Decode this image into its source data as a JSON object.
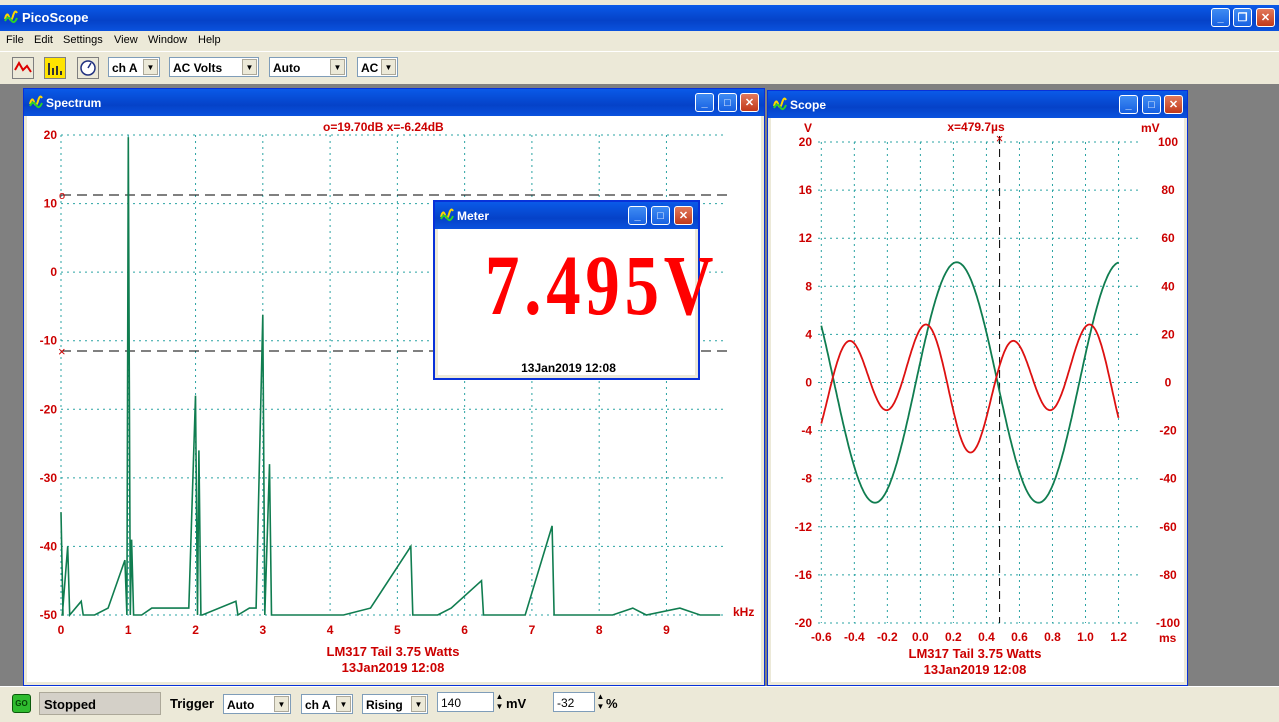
{
  "app": {
    "title": "PicoScope"
  },
  "menu": [
    "File",
    "Edit",
    "Settings",
    "View",
    "Window",
    "Help"
  ],
  "toolbar": {
    "channel": "ch A",
    "mode": "AC Volts",
    "range": "Auto",
    "coupling": "AC"
  },
  "spectrum": {
    "title": "Spectrum",
    "readout": "o=19.70dB  x=-6.24dB",
    "caption": "LM317 Tail 3.75 Watts",
    "date": "13Jan2019  12:08",
    "x_unit": "kHz",
    "y_ticks": [
      "20",
      "10",
      "0",
      "-10",
      "-20",
      "-30",
      "-40",
      "-50"
    ],
    "x_ticks": [
      "0",
      "1",
      "2",
      "3",
      "4",
      "5",
      "6",
      "7",
      "8",
      "9"
    ],
    "marker_o": "o",
    "marker_x": "×"
  },
  "meter": {
    "title": "Meter",
    "value": "7.495V",
    "date": "13Jan2019  12:08"
  },
  "scope": {
    "title": "Scope",
    "left_unit": "V",
    "right_unit": "mV",
    "readout": "x=479.7µs",
    "caption": "LM317 Tail 3.75 Watts",
    "date": "13Jan2019  12:08",
    "x_unit": "ms",
    "left_ticks": [
      "20",
      "16",
      "12",
      "8",
      "4",
      "0",
      "-4",
      "-8",
      "-12",
      "-16",
      "-20"
    ],
    "right_ticks": [
      "100",
      "80",
      "60",
      "40",
      "20",
      "0",
      "-20",
      "-40",
      "-60",
      "-80",
      "-100"
    ],
    "x_ticks": [
      "-0.6",
      "-0.4",
      "-0.2",
      "0.0",
      "0.2",
      "0.4",
      "0.6",
      "0.8",
      "1.0",
      "1.2"
    ],
    "marker_x": "×"
  },
  "status": {
    "go": "GO",
    "state": "Stopped",
    "trigger_label": "Trigger",
    "trigger_mode": "Auto",
    "trigger_channel": "ch A",
    "trigger_edge": "Rising",
    "level": "140",
    "level_unit": "mV",
    "delay": "-32",
    "delay_unit": "%"
  },
  "colors": {
    "green_trace": "#107d50",
    "red_trace": "#dd1111",
    "grid": "#2aa3a3",
    "axis_text": "#cc0000"
  },
  "chart_data": [
    {
      "type": "line",
      "name": "Spectrum",
      "xlabel": "kHz",
      "xlim": [
        0,
        9.9
      ],
      "ylim": [
        -50,
        20
      ],
      "series": [
        {
          "x": [
            0,
            0.02,
            0.1,
            0.5,
            0.95,
            1.0,
            1.05,
            1.2,
            1.9,
            2.0,
            2.05,
            2.1,
            2.9,
            3.0,
            3.1,
            3.15,
            4.2,
            5.2,
            6.25,
            7.3,
            8.7,
            9.2,
            9.8
          ],
          "y": [
            -35,
            -50,
            -40,
            -50,
            -42,
            19.7,
            -39,
            -50,
            -49,
            -18,
            -26,
            -50,
            -49,
            -6.2,
            -28,
            -50,
            -50,
            -40,
            -45,
            -37,
            -50,
            -49,
            -50
          ]
        }
      ],
      "markers": {
        "o": 19.7,
        "x": -6.24
      }
    },
    {
      "type": "line",
      "name": "Scope",
      "xlabel": "ms",
      "xlim": [
        -0.62,
        1.33
      ],
      "ylim_left": [
        -20,
        20
      ],
      "ylim_right": [
        -100,
        100
      ],
      "cursor_x": 0.4797,
      "series": [
        {
          "axis": "left",
          "unit": "V",
          "waveform": "sine",
          "amplitude": 10,
          "period_ms": 0.99,
          "peak_at_ms": 0.22
        },
        {
          "axis": "right",
          "unit": "mV",
          "waveform": "harmonic",
          "amplitude": 27,
          "period_ms": 0.495,
          "peaks_at_ms": [
            -0.48,
            -0.27,
            0.05,
            0.3,
            0.54,
            0.66,
            0.93,
            1.2
          ]
        }
      ]
    }
  ]
}
